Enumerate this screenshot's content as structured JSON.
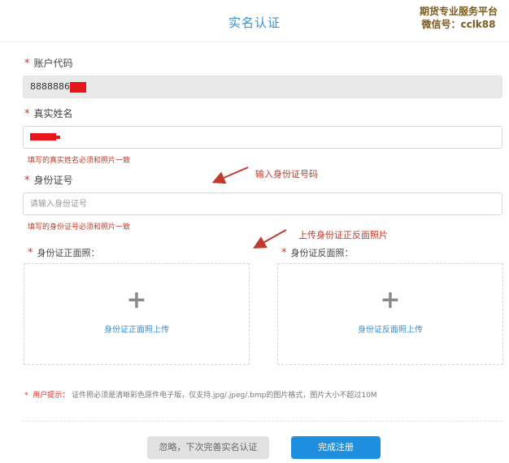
{
  "header": {
    "title": "实名认证"
  },
  "watermark": {
    "line1": "期货专业服务平台",
    "line2": "微信号：cclk88"
  },
  "required_mark": "*",
  "account": {
    "label": "账户代码",
    "value": "8888886"
  },
  "name": {
    "label": "真实姓名",
    "hint": "填写的真实姓名必须和照片一致"
  },
  "idnum": {
    "label": "身份证号",
    "placeholder": "请输入身份证号",
    "hint": "填写的身份证号必须和照片一致"
  },
  "annotations": {
    "id_input": "输入身份证号码",
    "id_upload": "上传身份证正反面照片"
  },
  "upload_front": {
    "label": "身份证正面照：",
    "plus": "+",
    "button": "身份证正面照上传"
  },
  "upload_back": {
    "label": "身份证反面照：",
    "plus": "+",
    "button": "身份证反面照上传"
  },
  "tip": {
    "star": "*",
    "head": "用户提示：",
    "text": "证件照必须是清晰彩色原件电子版，仅支持.jpg/.jpeg/.bmp的图片格式，图片大小不超过10M"
  },
  "buttons": {
    "skip": "忽略，下次完善实名认证",
    "submit": "完成注册"
  },
  "colors": {
    "accent": "#1e8fe0",
    "title": "#3a8fd0",
    "required": "#e02a2a",
    "hint": "#c0392b",
    "redaction": "#e8151b"
  }
}
